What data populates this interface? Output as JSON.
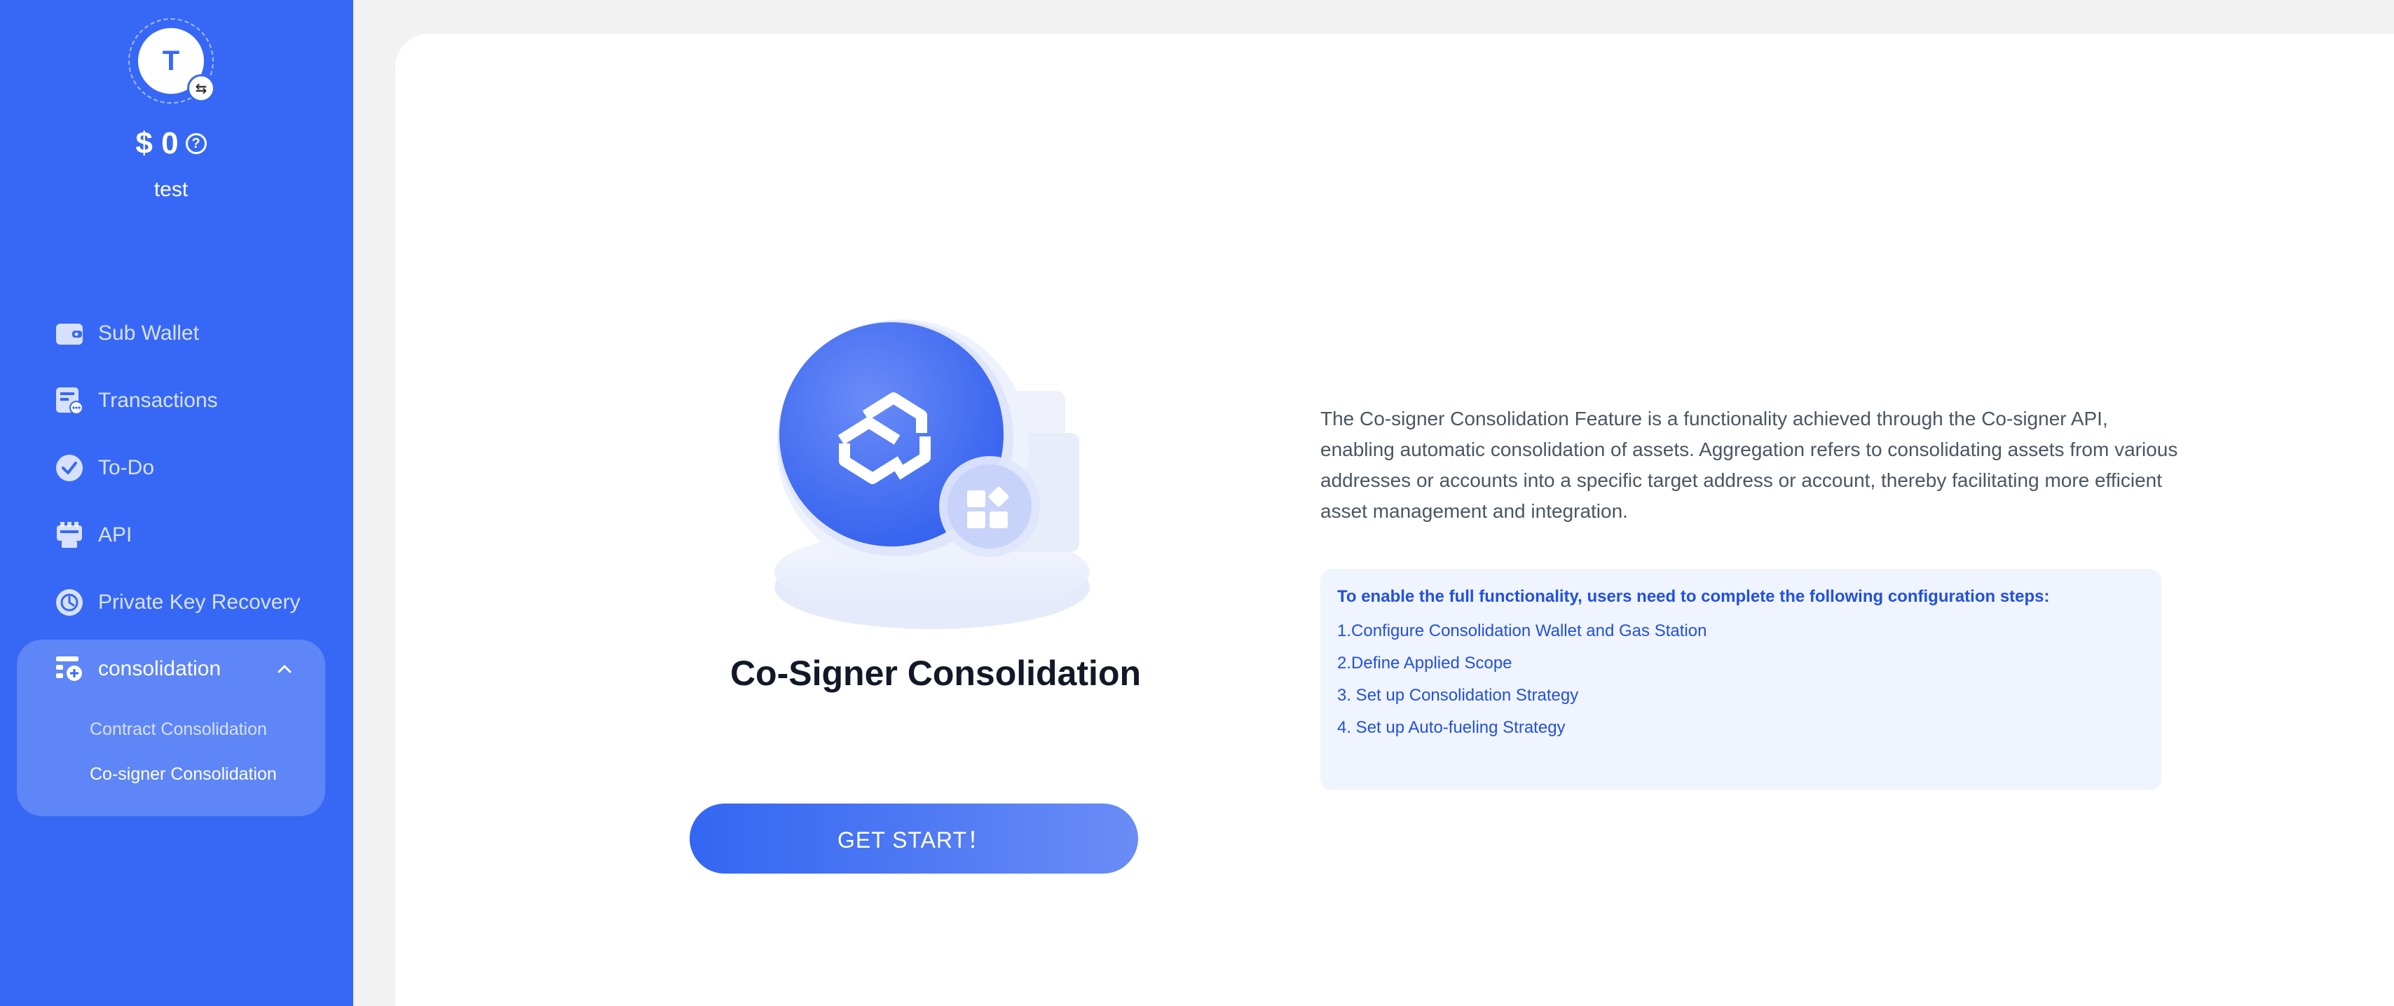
{
  "sidebar": {
    "avatar_letter": "T",
    "switch_icon": "⇆",
    "balance": "$ 0",
    "help_icon": "?",
    "username": "test",
    "items": [
      {
        "label": "Sub Wallet",
        "icon": "wallet-icon"
      },
      {
        "label": "Transactions",
        "icon": "transactions-icon"
      },
      {
        "label": "To-Do",
        "icon": "check-circle-icon"
      },
      {
        "label": "API",
        "icon": "api-icon"
      },
      {
        "label": "Private Key Recovery",
        "icon": "key-recovery-icon"
      }
    ],
    "group": {
      "label": "consolidation",
      "icon": "consolidation-icon",
      "sub_items": [
        {
          "label": "Contract Consolidation",
          "active": false
        },
        {
          "label": "Co-signer Consolidation",
          "active": true
        }
      ]
    }
  },
  "main": {
    "title": "Co-Signer Consolidation",
    "start_button": "GET START！",
    "description": "The Co-signer Consolidation Feature is a functionality achieved through the Co-signer API, enabling automatic consolidation of assets. Aggregation refers to consolidating assets from various addresses or accounts into a specific target address or account, thereby facilitating more efficient asset management and integration.",
    "steps_title": "To enable the full functionality, users need to complete the following configuration steps:",
    "steps": [
      "1.Configure Consolidation Wallet and Gas Station",
      "2.Define Applied Scope",
      "3. Set up Consolidation Strategy",
      "4. Set up Auto-fueling Strategy"
    ]
  },
  "colors": {
    "sidebar_bg": "#3768f5",
    "accent": "#2250e0",
    "steps_bg": "#eff4fe"
  }
}
